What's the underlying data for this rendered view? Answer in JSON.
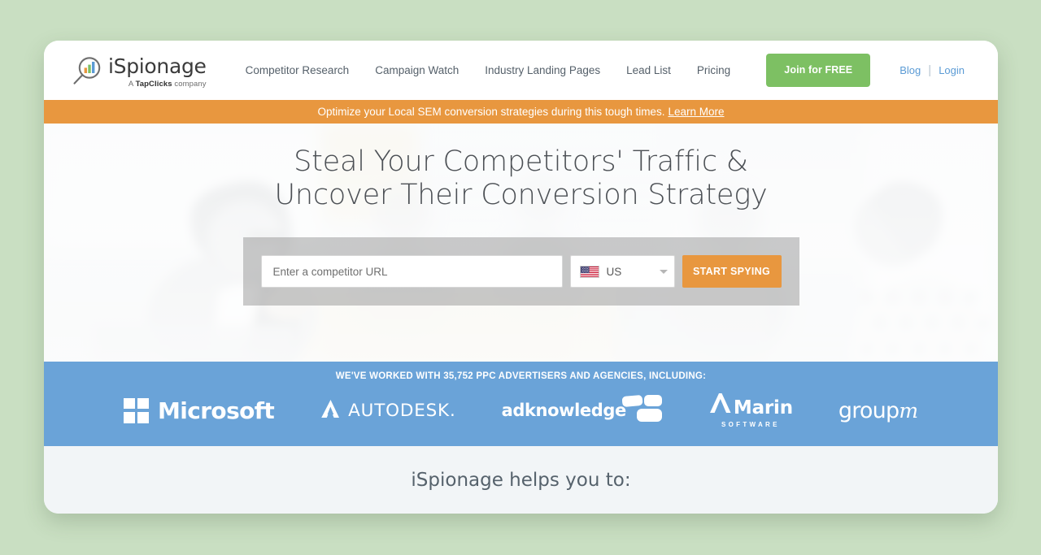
{
  "brand": {
    "name": "iSpionage",
    "tagline_prefix": "A ",
    "tagline_bold": "TapClicks",
    "tagline_suffix": " company",
    "logo_icon": "magnifier-bar-chart-icon"
  },
  "nav": {
    "items": [
      {
        "label": "Competitor Research"
      },
      {
        "label": "Campaign Watch"
      },
      {
        "label": "Industry Landing Pages"
      },
      {
        "label": "Lead List"
      },
      {
        "label": "Pricing"
      }
    ]
  },
  "header": {
    "join_label": "Join for FREE",
    "blog_label": "Blog",
    "separator": "|",
    "login_label": "Login"
  },
  "announcement": {
    "text": "Optimize your Local SEM conversion strategies during this tough times.",
    "link_label": "Learn More"
  },
  "hero": {
    "title_line1": "Steal Your Competitors' Traffic &",
    "title_line2": "Uncover Their Conversion Strategy",
    "search": {
      "url_value": "",
      "url_placeholder": "Enter a competitor URL",
      "country_code": "US",
      "country_flag_icon": "us-flag-icon",
      "dropdown_icon": "chevron-down-icon",
      "submit_label": "START SPYING"
    }
  },
  "clients": {
    "caption": "WE'VE WORKED WITH 35,752 PPC ADVERTISERS AND AGENCIES, INCLUDING:",
    "logos": [
      {
        "name": "Microsoft",
        "icon": "microsoft-squares-icon"
      },
      {
        "name": "AUTODESK.",
        "icon": "autodesk-a-icon"
      },
      {
        "name": "adknowledge",
        "icon": "adknowledge-blocks-icon"
      },
      {
        "name": "Marin",
        "sub": "SOFTWARE",
        "icon": "marin-m-icon"
      },
      {
        "name": "group",
        "suffix": "m",
        "icon": "groupm-icon"
      }
    ]
  },
  "helps": {
    "title": "iSpionage helps you to:"
  },
  "colors": {
    "page_background": "#c9dfc2",
    "accent_orange": "#e8973f",
    "accent_green": "#7dc063",
    "accent_blue": "#6aa3d8",
    "link_blue": "#5b9bd5"
  }
}
